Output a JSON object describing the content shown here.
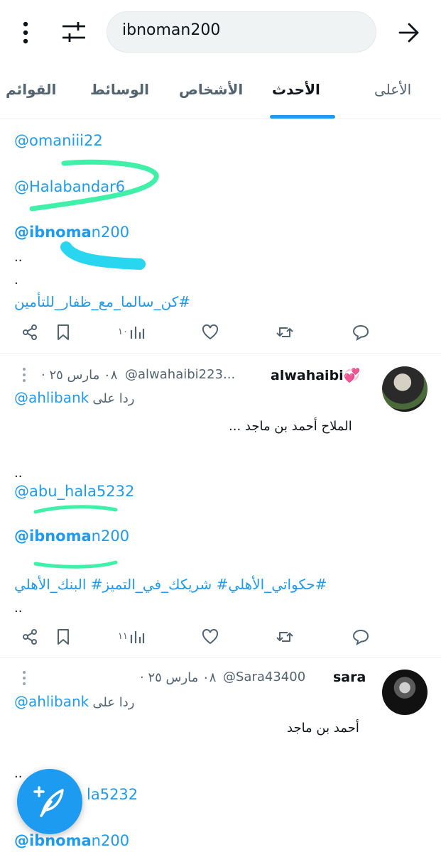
{
  "search": {
    "query": "ibnoman200"
  },
  "tabs": [
    "الأعلى",
    "الأحدث",
    "الأشخاص",
    "الوسائط",
    "القوائم"
  ],
  "tweet1": {
    "mention1": "@omaniii22",
    "mention2": "@Halabandar6",
    "mention3_bold": "@ibnoma",
    "mention3_rest": "n200",
    "dots1": "..",
    "dots2": ".",
    "hashtag": "#كن_سالما_مع_ظفار_للتأمين",
    "views": "١٠"
  },
  "tweet2": {
    "name": "alwahaibi",
    "name_emoji": "💞",
    "handle": "@alwahaibi223...",
    "date": "٠٨ مارس ٢٥ ·",
    "reply_prefix": "ردا على",
    "reply_to": "@ahlibank",
    "text": "الملاح أحمد بن ماجد ...",
    "dots1": "..",
    "mention1": "@abu_hala5232",
    "mention2_bold": "@ibnoma",
    "mention2_rest": "n200",
    "hashtags": "#حكواتي_الأهلي# شريكك_في_التميز# البنك_الأهلي",
    "dots2": "..",
    "views": "١١"
  },
  "tweet3": {
    "name": "sara",
    "handle": "@Sara43400",
    "date": "٠٨ مارس ٢٥ ·",
    "reply_prefix": "ردا على",
    "reply_to": "@ahlibank",
    "text": "أحمد بن ماجد",
    "dots1": "..",
    "mention1_visible": "la5232",
    "mention2_bold": "@ibnoma",
    "mention2_rest": "n200"
  },
  "colors": {
    "accent": "#1d9bf0",
    "highlight_green": "#3ff0a8",
    "highlight_cyan": "#29d6f0"
  }
}
